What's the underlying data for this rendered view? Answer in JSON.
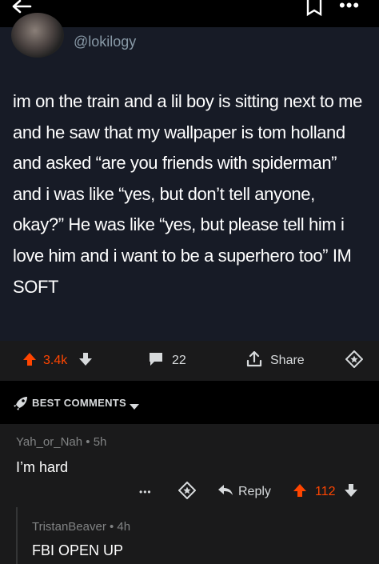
{
  "post": {
    "handle": "@lokilogy",
    "text": "im on the train and a lil boy is sitting next to me and he saw that my wallpaper is tom holland and asked “are you friends with spiderman” and i was like “yes, but don’t tell anyone, okay?” He was like “yes, but please tell him i love him and i want to be a superhero too” IM SOFT"
  },
  "actions": {
    "score": "3.4k",
    "comments": "22",
    "share": "Share"
  },
  "sort": {
    "label": "BEST COMMENTS"
  },
  "comments": [
    {
      "author": "Yah_or_Nah",
      "age": "5h",
      "body": "I’m hard",
      "reply": "Reply",
      "score": "112"
    },
    {
      "author": "TristanBeaver",
      "age": "4h",
      "body": "FBI OPEN UP"
    }
  ],
  "colors": {
    "upvote": "#ff4500",
    "background": "#000000",
    "panel": "#1a1a1b",
    "tweet_bg": "#171b26"
  },
  "icons": [
    "back-arrow-icon",
    "bookmark-icon",
    "more-icon",
    "upvote-icon",
    "downvote-icon",
    "comment-icon",
    "share-icon",
    "award-icon",
    "rocket-icon",
    "chevron-down-icon",
    "reply-icon"
  ]
}
